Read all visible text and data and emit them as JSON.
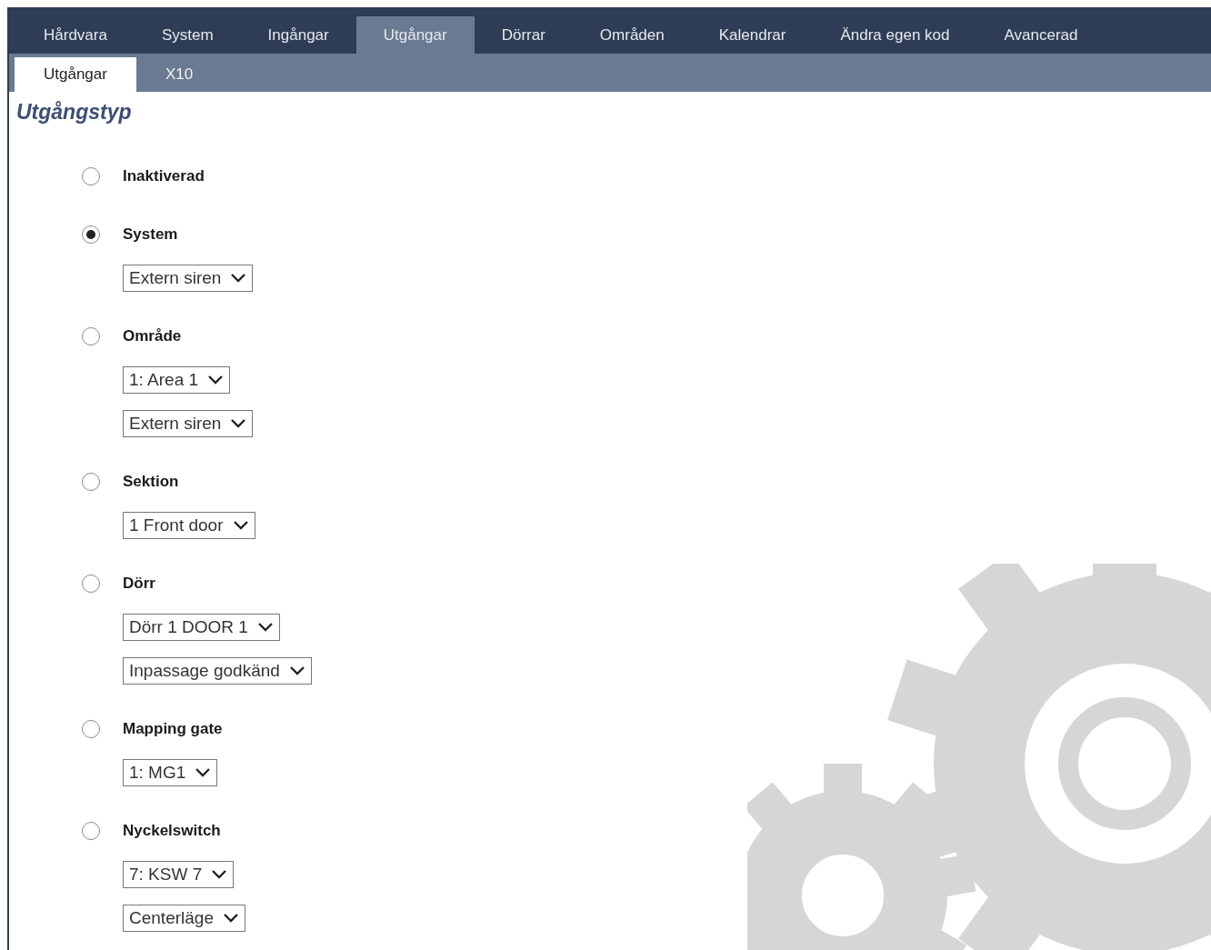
{
  "main_tabs": [
    {
      "label": "Hårdvara",
      "selected": false
    },
    {
      "label": "System",
      "selected": false
    },
    {
      "label": "Ingångar",
      "selected": false
    },
    {
      "label": "Utgångar",
      "selected": true
    },
    {
      "label": "Dörrar",
      "selected": false
    },
    {
      "label": "Områden",
      "selected": false
    },
    {
      "label": "Kalendrar",
      "selected": false
    },
    {
      "label": "Ändra egen kod",
      "selected": false
    },
    {
      "label": "Avancerad",
      "selected": false
    }
  ],
  "sub_tabs": [
    {
      "label": "Utgångar",
      "selected": true
    },
    {
      "label": "X10",
      "selected": false
    }
  ],
  "heading": "Utgångstyp",
  "output_types": [
    {
      "label": "Inaktiverad",
      "selected": false
    },
    {
      "label": "System",
      "selected": true,
      "dropdowns": [
        "Extern siren"
      ]
    },
    {
      "label": "Område",
      "selected": false,
      "dropdowns": [
        "1: Area 1",
        "Extern siren"
      ]
    },
    {
      "label": "Sektion",
      "selected": false,
      "dropdowns": [
        "1 Front door"
      ]
    },
    {
      "label": "Dörr",
      "selected": false,
      "dropdowns": [
        "Dörr 1 DOOR 1",
        "Inpassage godkänd"
      ]
    },
    {
      "label": "Mapping gate",
      "selected": false,
      "dropdowns": [
        "1: MG1"
      ]
    },
    {
      "label": "Nyckelswitch",
      "selected": false,
      "dropdowns": [
        "7: KSW 7",
        "Centerläge"
      ]
    }
  ]
}
